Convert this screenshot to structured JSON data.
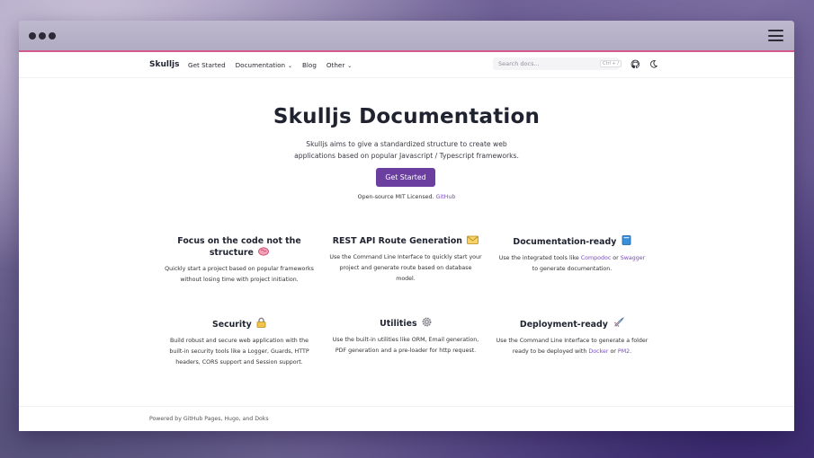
{
  "nav": {
    "brand": "Skulljs",
    "links": {
      "get_started": "Get Started",
      "documentation": "Documentation",
      "blog": "Blog",
      "other": "Other"
    },
    "search_placeholder": "Search docs...",
    "search_shortcut": "Ctrl + /",
    "github_icon": "github-icon",
    "theme_icon": "moon-icon"
  },
  "hero": {
    "title": "Skulljs Documentation",
    "lead_line1": "Skulljs aims to give a standardized structure to create web",
    "lead_line2": "applications based on popular Javascript / Typescript frameworks.",
    "cta": "Get Started",
    "license_text": "Open-source MIT Licensed.",
    "license_link": "GitHub"
  },
  "features": {
    "focus": {
      "title": "Focus on the code not the structure",
      "text": "Quickly start a project based on popular frameworks without losing time with project initiation.",
      "icon": "brain-icon"
    },
    "rest": {
      "title": "REST API Route Generation",
      "text": "Use the Command Line Interface to quickly start your project and generate route based on database model.",
      "icon": "envelope-icon"
    },
    "docs": {
      "title": "Documentation-ready",
      "text_before": "Use the integrated tools like ",
      "link1": "Compodoc",
      "text_mid": " or ",
      "link2": "Swagger",
      "text_after": " to generate documentation.",
      "icon": "book-icon"
    },
    "security": {
      "title": "Security",
      "text": "Build robust and secure web application with the built-in security tools like a Logger, Guards, HTTP headers, CORS support and Session support.",
      "icon": "lock-icon"
    },
    "utilities": {
      "title": "Utilities",
      "text": "Use the built-in utilities like ORM, Email generation, PDF generation and a pre-loader for http request.",
      "icon": "gear-icon"
    },
    "deploy": {
      "title": "Deployment-ready",
      "text_before": "Use the Command Line Interface to generate a folder ready to be deployed with ",
      "link1": "Docker",
      "text_mid": " or ",
      "link2": "PM2",
      "text_after": ".",
      "icon": "rocket-icon"
    }
  },
  "footer": {
    "text": "Powered by GitHub Pages, Hugo, and Doks"
  },
  "colors": {
    "accent": "#6b3fa0",
    "link": "#7a4cc3",
    "titlebar_border": "#d45a8e"
  }
}
